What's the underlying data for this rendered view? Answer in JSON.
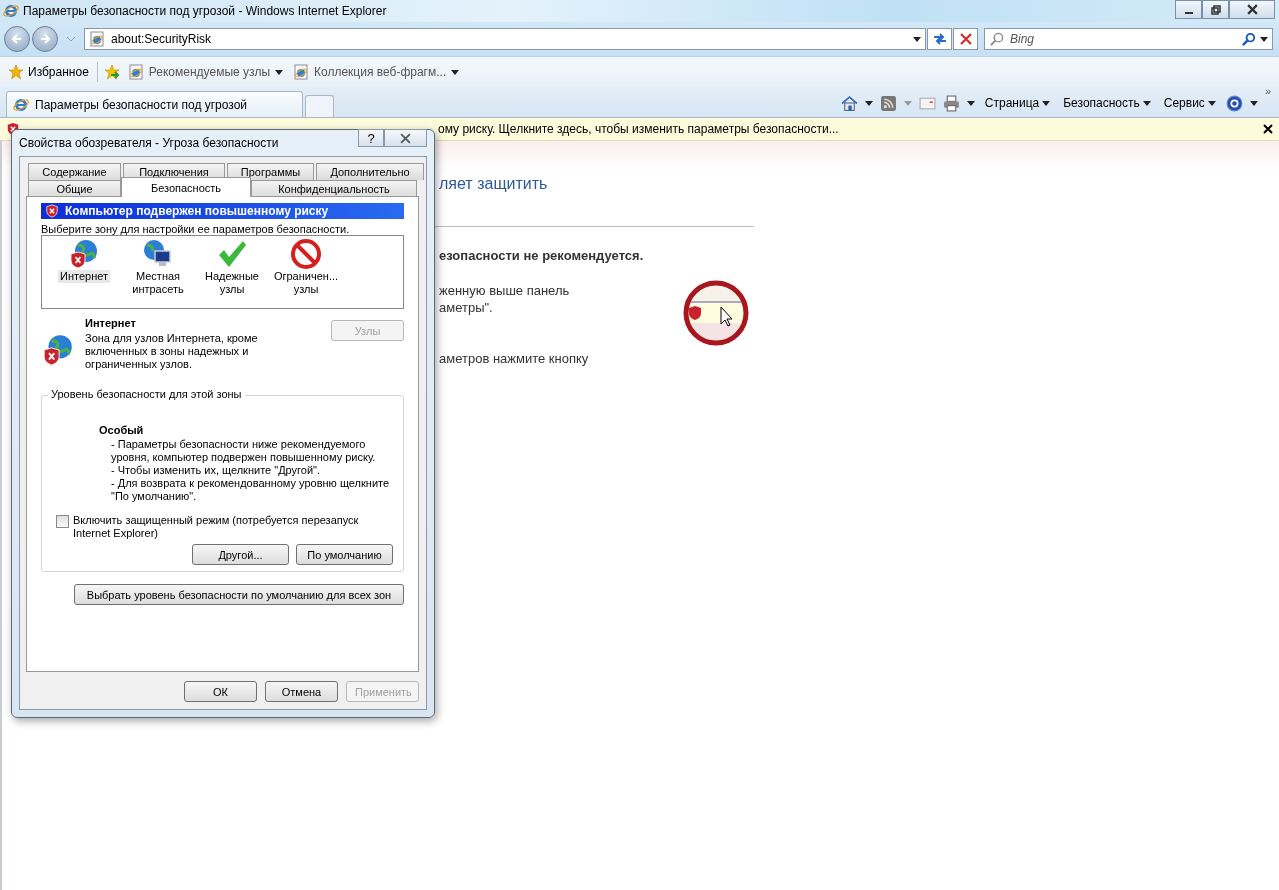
{
  "window": {
    "title": "Параметры безопасности под угрозой - Windows Internet Explorer"
  },
  "nav": {
    "address": "about:SecurityRisk",
    "search_placeholder": "Bing"
  },
  "favorites_bar": {
    "label": "Избранное",
    "links": [
      {
        "label": "Рекомендуемые узлы"
      },
      {
        "label": "Коллекция веб-фрагм..."
      }
    ]
  },
  "tabs": [
    {
      "label": "Параметры безопасности под угрозой",
      "selected": true
    }
  ],
  "command_bar": {
    "menus": [
      "Страница",
      "Безопасность",
      "Сервис"
    ],
    "overflow": "»"
  },
  "info_bar": {
    "text": "ому риску. Щелкните здесь, чтобы изменить параметры безопасности..."
  },
  "page": {
    "heading": "ляет защитить",
    "warning": "езопасности не рекомендуется.",
    "paragraphs": [
      [
        "женную выше панель",
        "аметры\"."
      ],
      [
        "аметров нажмите кнопку"
      ]
    ]
  },
  "dialog": {
    "title": "Свойства обозревателя - Угроза безопасности",
    "help_button": "?",
    "tab_rows": [
      [
        {
          "label": "Содержание",
          "selected": false
        },
        {
          "label": "Подключения",
          "selected": false
        },
        {
          "label": "Программы",
          "selected": false
        },
        {
          "label": "Дополнительно",
          "selected": false
        }
      ],
      [
        {
          "label": "Общие",
          "selected": false
        },
        {
          "label": "Безопасность",
          "selected": true
        },
        {
          "label": "Конфиденциальность",
          "selected": false
        }
      ]
    ],
    "banner": "Компьютер подвержен повышенному риску",
    "zone_prompt": "Выберите зону для настройки ее параметров безопасности.",
    "zones": [
      {
        "kind": "internet",
        "label": "Интернет",
        "selected": true
      },
      {
        "kind": "intranet",
        "label": "Местная интрасеть",
        "selected": false
      },
      {
        "kind": "trusted",
        "label": "Надежные узлы",
        "selected": false
      },
      {
        "kind": "restricted",
        "label": "Ограничен... узлы",
        "selected": false
      }
    ],
    "zone_name": "Интернет",
    "zone_description": "Зона для узлов Интернета, кроме включенных в зоны надежных и ограниченных узлов.",
    "sites_button": {
      "label": "Узлы",
      "disabled": true
    },
    "level_group": {
      "legend": "Уровень безопасности для этой зоны",
      "level_name": "Особый",
      "notes": [
        "- Параметры безопасности ниже рекомендуемого уровня, компьютер подвержен повышенному риску.",
        "- Чтобы изменить их, щелкните \"Другой\".",
        "- Для возврата к рекомендованному уровню щелкните \"По умолчанию\"."
      ],
      "protected_mode": {
        "label": "Включить защищенный режим (потребуется перезапуск Internet Explorer)",
        "checked": false
      },
      "buttons": [
        {
          "label": "Другой...",
          "disabled": false
        },
        {
          "label": "По умолчанию",
          "disabled": false
        }
      ]
    },
    "reset_all_button": {
      "label": "Выбрать уровень безопасности по умолчанию для всех зон",
      "disabled": false
    },
    "footer_buttons": [
      {
        "label": "ОК",
        "disabled": false
      },
      {
        "label": "Отмена",
        "disabled": false
      },
      {
        "label": "Применить",
        "disabled": true
      }
    ]
  }
}
